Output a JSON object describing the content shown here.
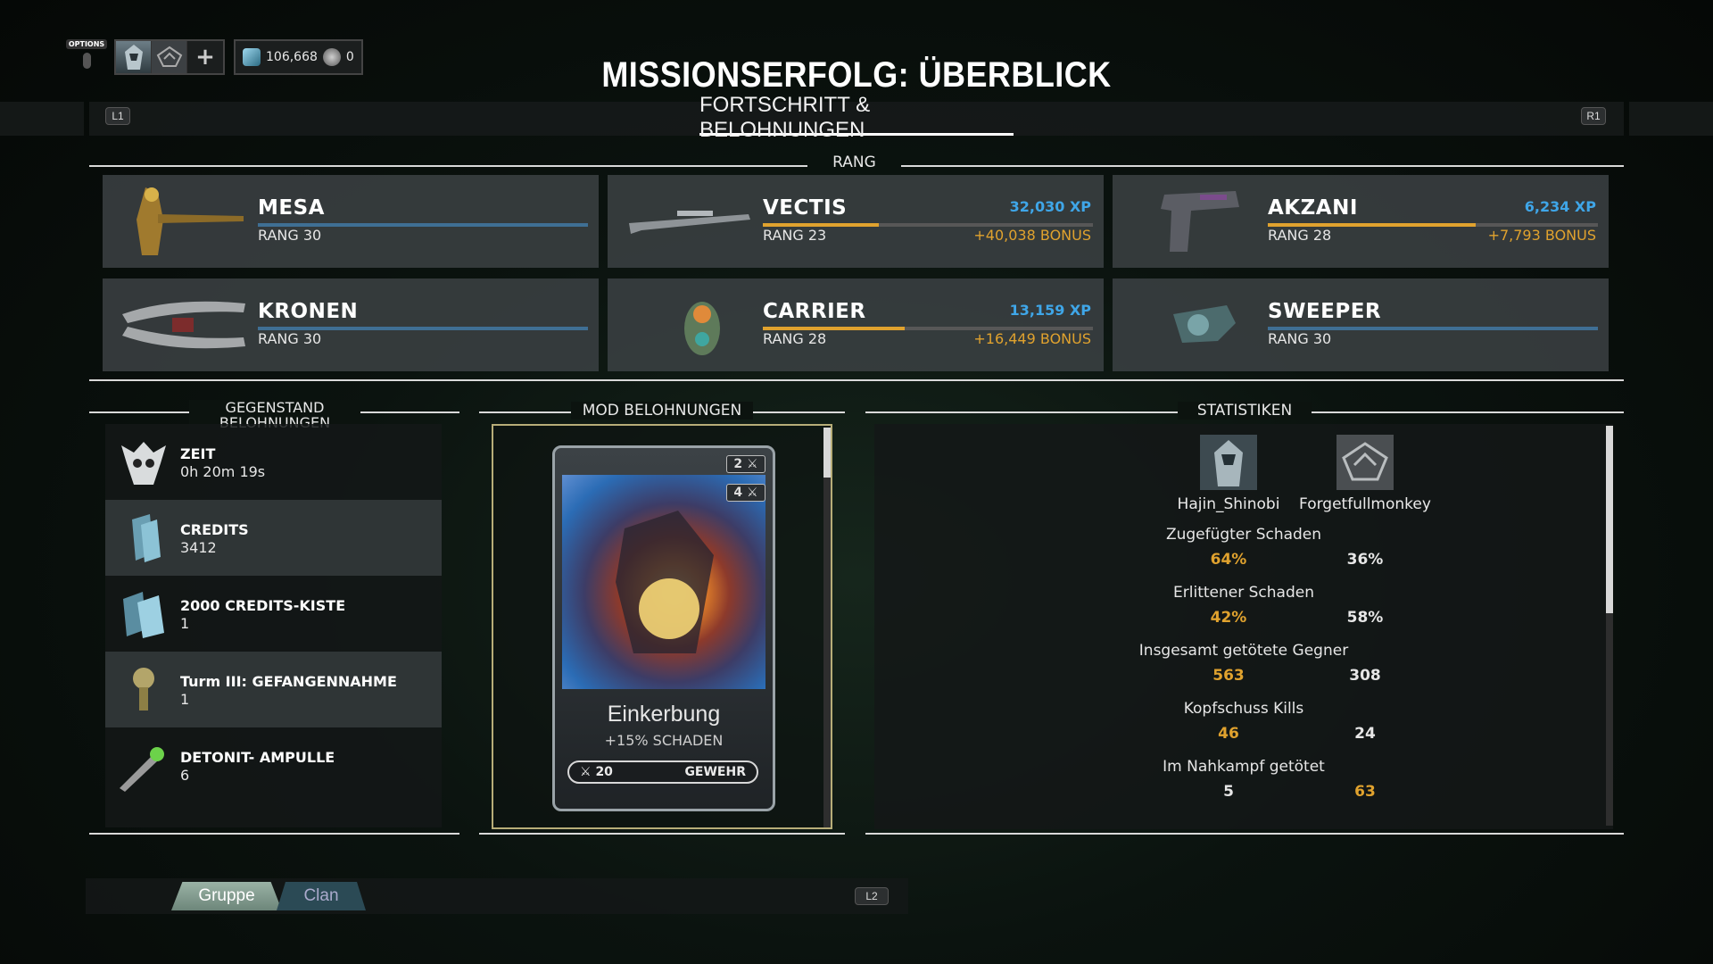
{
  "hud": {
    "options_label": "OPTIONS",
    "credits": "106,668",
    "platinum": "0"
  },
  "title": "MISSIONSERFOLG: ÜBERBLICK",
  "tabs": {
    "left_hint": "L1",
    "right_hint": "R1",
    "active": "FORTSCHRITT & BELOHNUNGEN"
  },
  "rank_section": {
    "title": "RANG",
    "cards": [
      {
        "name": "MESA",
        "rank": "RANG 30",
        "xp": "",
        "bonus": "",
        "progress": 1.0,
        "maxed": true
      },
      {
        "name": "VECTIS",
        "rank": "RANG 23",
        "xp": "32,030 XP",
        "bonus": "+40,038 BONUS",
        "progress": 0.35,
        "maxed": false
      },
      {
        "name": "AKZANI",
        "rank": "RANG 28",
        "xp": "6,234 XP",
        "bonus": "+7,793 BONUS",
        "progress": 0.63,
        "maxed": false
      },
      {
        "name": "KRONEN",
        "rank": "RANG 30",
        "xp": "",
        "bonus": "",
        "progress": 1.0,
        "maxed": true
      },
      {
        "name": "CARRIER",
        "rank": "RANG 28",
        "xp": "13,159 XP",
        "bonus": "+16,449 BONUS",
        "progress": 0.43,
        "maxed": false
      },
      {
        "name": "SWEEPER",
        "rank": "RANG 30",
        "xp": "",
        "bonus": "",
        "progress": 1.0,
        "maxed": true
      }
    ]
  },
  "items_section": {
    "title_line1": "GEGENSTAND",
    "title_line2": "BELOHNUNGEN",
    "items": [
      {
        "label": "ZEIT",
        "count": "0h 20m 19s",
        "icon": "clock-skull-icon"
      },
      {
        "label": "CREDITS",
        "count": "3412",
        "icon": "credits-icon"
      },
      {
        "label": "2000 CREDITS-KISTE",
        "count": "1",
        "icon": "credits-cache-icon"
      },
      {
        "label": "Turm III: GEFANGENNAHME",
        "count": "1",
        "icon": "key-icon"
      },
      {
        "label": "DETONIT- AMPULLE",
        "count": "6",
        "icon": "ampule-icon"
      }
    ]
  },
  "mod_section": {
    "title": "MOD BELOHNUNGEN",
    "mod": {
      "name": "Einkerbung",
      "effect": "+15% SCHADEN",
      "drain": "20",
      "type": "GEWEHR",
      "chip1": "2",
      "chip2": "4"
    }
  },
  "stats_section": {
    "title": "STATISTIKEN",
    "players": [
      "Hajin_Shinobi",
      "Forgetfullmonkey"
    ],
    "stats": [
      {
        "label": "Zugefügter Schaden",
        "p1": "64%",
        "p2": "36%",
        "leader": 1
      },
      {
        "label": "Erlittener Schaden",
        "p1": "42%",
        "p2": "58%",
        "leader": 1
      },
      {
        "label": "Insgesamt getötete Gegner",
        "p1": "563",
        "p2": "308",
        "leader": 1
      },
      {
        "label": "Kopfschuss Kills",
        "p1": "46",
        "p2": "24",
        "leader": 1
      },
      {
        "label": "Im Nahkampf getötet",
        "p1": "5",
        "p2": "63",
        "leader": 2
      }
    ]
  },
  "bottom": {
    "tab_group": "Gruppe",
    "tab_clan": "Clan",
    "hint": "L2"
  },
  "colors": {
    "accent_orange": "#e0a22e",
    "accent_blue": "#3fa6e8",
    "bar_blue": "#3f6f94"
  }
}
